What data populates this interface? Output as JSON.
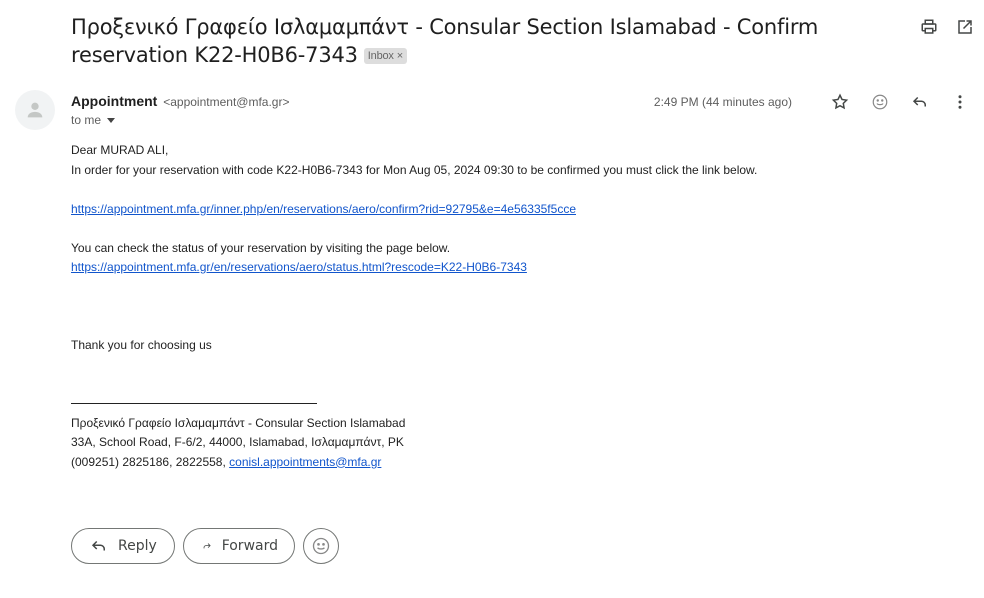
{
  "email": {
    "subject": "Προξενικό Γραφείο Ισλαμαμπάντ - Consular Section Islamabad - Confirm reservation K22-H0B6-7343",
    "label_chip": "Inbox",
    "label_chip_close": "×",
    "toolbar_icons": [
      "print-icon",
      "open-in-new-window-icon"
    ],
    "sender": {
      "name": "Appointment",
      "email": "<appointment@mfa.gr>",
      "to": "to me"
    },
    "timestamp": "2:49 PM (44 minutes ago)",
    "header_actions": [
      "star-icon",
      "emoji-reaction-icon",
      "reply-icon",
      "more-options-icon"
    ],
    "body": {
      "greeting": "Dear MURAD ALI,",
      "line1": "In order for your reservation with code K22-H0B6-7343 for Mon Aug 05, 2024 09:30 to be confirmed you must click the link below.",
      "confirm_link": "https://appointment.mfa.gr/inner.php/en/reservations/aero/confirm?rid=92795&e=4e56335f5cce",
      "status_text": "You can check the status of your reservation by visiting the page below.",
      "status_link": "https://appointment.mfa.gr/en/reservations/aero/status.html?rescode=K22-H0B6-7343",
      "thanks": "Thank you for choosing us",
      "signature": {
        "line1": "Προξενικό Γραφείο Ισλαμαμπάντ - Consular Section Islamabad",
        "line2": "33A, School Road, F-6/2, 44000, Islamabad, Ισλαμαμπάντ, PK",
        "phones": "(009251) 2825186, 2822558, ",
        "email_link": "conisl.appointments@mfa.gr"
      }
    },
    "actions": {
      "reply": "Reply",
      "forward": "Forward"
    }
  }
}
